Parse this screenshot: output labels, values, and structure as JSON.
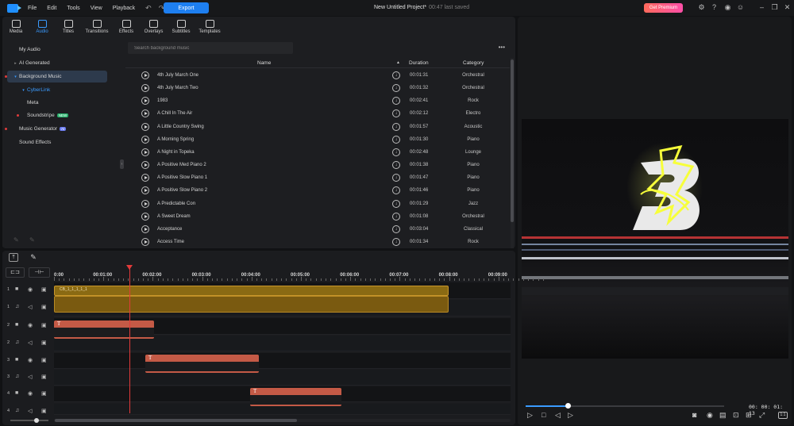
{
  "menu": [
    "File",
    "Edit",
    "Tools",
    "View",
    "Playback"
  ],
  "toolbar": {
    "export_label": "Export",
    "premium_label": "Get Premium"
  },
  "project": {
    "title": "New Untitled Project*",
    "saved": "00:47 last saved"
  },
  "tabs": [
    "Media",
    "Audio",
    "Titles",
    "Transitions",
    "Effects",
    "Overlays",
    "Subtitles",
    "Templates"
  ],
  "sidebar": {
    "items": [
      {
        "label": "My Audio"
      },
      {
        "label": "AI Generated"
      },
      {
        "label": "Background Music"
      },
      {
        "label": "CyberLink"
      },
      {
        "label": "Meta"
      },
      {
        "label": "Soundstripe",
        "badge": "NEW"
      },
      {
        "label": "Music Generator",
        "badge": "AI"
      },
      {
        "label": "Sound Effects"
      }
    ]
  },
  "search": {
    "placeholder": "Search background music"
  },
  "table": {
    "headers": {
      "name": "Name",
      "duration": "Duration",
      "category": "Category"
    },
    "rows": [
      {
        "name": "4th July March One",
        "duration": "00:01:31",
        "category": "Orchestral"
      },
      {
        "name": "4th July March Two",
        "duration": "00:01:32",
        "category": "Orchestral"
      },
      {
        "name": "1983",
        "duration": "00:02:41",
        "category": "Rock"
      },
      {
        "name": "A Chill In The Air",
        "duration": "00:02:12",
        "category": "Electro"
      },
      {
        "name": "A Little Country Swing",
        "duration": "00:01:57",
        "category": "Acoustic"
      },
      {
        "name": "A Morning Spring",
        "duration": "00:01:30",
        "category": "Piano"
      },
      {
        "name": "A Night in Topeka",
        "duration": "00:02:48",
        "category": "Lounge"
      },
      {
        "name": "A Positive Med Piano 2",
        "duration": "00:01:38",
        "category": "Piano"
      },
      {
        "name": "A Positive Slow Piano 1",
        "duration": "00:01:47",
        "category": "Piano"
      },
      {
        "name": "A Positive Slow Piano 2",
        "duration": "00:01:46",
        "category": "Piano"
      },
      {
        "name": "A Predictable Con",
        "duration": "00:01:29",
        "category": "Jazz"
      },
      {
        "name": "A Sweet Dream",
        "duration": "00:01:08",
        "category": "Orchestral"
      },
      {
        "name": "Acceptance",
        "duration": "00:03:04",
        "category": "Classical"
      },
      {
        "name": "Access Time",
        "duration": "00:01:34",
        "category": "Rock"
      }
    ]
  },
  "preview": {
    "timecode": "00: 00: 01: 13",
    "ratio": "1:1",
    "progress": 0.21
  },
  "timeline": {
    "ruler": [
      "0:00",
      "00:01:00",
      "00:02:00",
      "00:03:00",
      "00:04:00",
      "00:05:00",
      "00:06:00",
      "00:07:00",
      "00:08:00",
      "00:09:00"
    ],
    "tracks": [
      "1",
      "1",
      "2",
      "2",
      "3",
      "3",
      "4",
      "4"
    ],
    "video_clip_label": "CB_1_1_1_1_1",
    "title_glyph": "T"
  },
  "colors": {
    "accent": "#1e7ff0",
    "playhead": "#e23a3a",
    "video_clip": "#8a6a13",
    "title_clip": "#c45a46"
  }
}
